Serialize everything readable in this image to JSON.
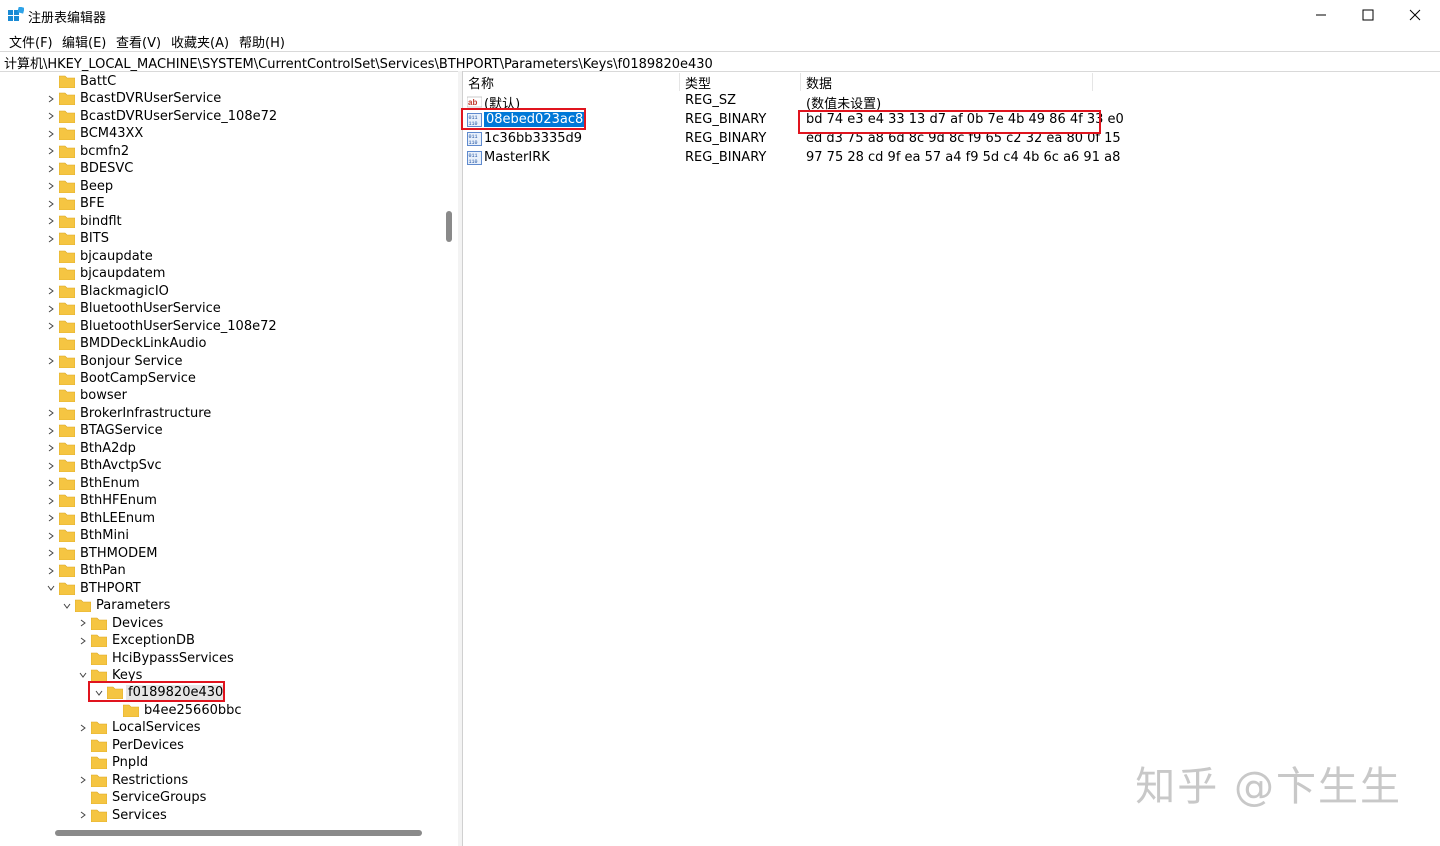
{
  "window": {
    "title": "注册表编辑器"
  },
  "menu": [
    "文件(F)",
    "编辑(E)",
    "查看(V)",
    "收藏夹(A)",
    "帮助(H)"
  ],
  "address": "计算机\\HKEY_LOCAL_MACHINE\\SYSTEM\\CurrentControlSet\\Services\\BTHPORT\\Parameters\\Keys\\f0189820e430",
  "tree": {
    "items": [
      {
        "label": "BattC",
        "level": 0,
        "expander": "none"
      },
      {
        "label": "BcastDVRUserService",
        "level": 0,
        "expander": "collapsed"
      },
      {
        "label": "BcastDVRUserService_108e72",
        "level": 0,
        "expander": "collapsed"
      },
      {
        "label": "BCM43XX",
        "level": 0,
        "expander": "collapsed"
      },
      {
        "label": "bcmfn2",
        "level": 0,
        "expander": "collapsed"
      },
      {
        "label": "BDESVC",
        "level": 0,
        "expander": "collapsed"
      },
      {
        "label": "Beep",
        "level": 0,
        "expander": "collapsed"
      },
      {
        "label": "BFE",
        "level": 0,
        "expander": "collapsed"
      },
      {
        "label": "bindflt",
        "level": 0,
        "expander": "collapsed"
      },
      {
        "label": "BITS",
        "level": 0,
        "expander": "collapsed"
      },
      {
        "label": "bjcaupdate",
        "level": 0,
        "expander": "none"
      },
      {
        "label": "bjcaupdatem",
        "level": 0,
        "expander": "none"
      },
      {
        "label": "BlackmagicIO",
        "level": 0,
        "expander": "collapsed"
      },
      {
        "label": "BluetoothUserService",
        "level": 0,
        "expander": "collapsed"
      },
      {
        "label": "BluetoothUserService_108e72",
        "level": 0,
        "expander": "collapsed"
      },
      {
        "label": "BMDDeckLinkAudio",
        "level": 0,
        "expander": "none"
      },
      {
        "label": "Bonjour Service",
        "level": 0,
        "expander": "collapsed"
      },
      {
        "label": "BootCampService",
        "level": 0,
        "expander": "none"
      },
      {
        "label": "bowser",
        "level": 0,
        "expander": "none"
      },
      {
        "label": "BrokerInfrastructure",
        "level": 0,
        "expander": "collapsed"
      },
      {
        "label": "BTAGService",
        "level": 0,
        "expander": "collapsed"
      },
      {
        "label": "BthA2dp",
        "level": 0,
        "expander": "collapsed"
      },
      {
        "label": "BthAvctpSvc",
        "level": 0,
        "expander": "collapsed"
      },
      {
        "label": "BthEnum",
        "level": 0,
        "expander": "collapsed"
      },
      {
        "label": "BthHFEnum",
        "level": 0,
        "expander": "collapsed"
      },
      {
        "label": "BthLEEnum",
        "level": 0,
        "expander": "collapsed"
      },
      {
        "label": "BthMini",
        "level": 0,
        "expander": "collapsed"
      },
      {
        "label": "BTHMODEM",
        "level": 0,
        "expander": "collapsed"
      },
      {
        "label": "BthPan",
        "level": 0,
        "expander": "collapsed"
      },
      {
        "label": "BTHPORT",
        "level": 0,
        "expander": "expanded"
      },
      {
        "label": "Parameters",
        "level": 1,
        "expander": "expanded"
      },
      {
        "label": "Devices",
        "level": 2,
        "expander": "collapsed"
      },
      {
        "label": "ExceptionDB",
        "level": 2,
        "expander": "collapsed"
      },
      {
        "label": "HciBypassServices",
        "level": 2,
        "expander": "none"
      },
      {
        "label": "Keys",
        "level": 2,
        "expander": "expanded"
      },
      {
        "label": "f0189820e430",
        "level": 3,
        "expander": "expanded",
        "selected": true
      },
      {
        "label": "b4ee25660bbc",
        "level": 4,
        "expander": "none"
      },
      {
        "label": "LocalServices",
        "level": 2,
        "expander": "collapsed"
      },
      {
        "label": "PerDevices",
        "level": 2,
        "expander": "none"
      },
      {
        "label": "PnpId",
        "level": 2,
        "expander": "none"
      },
      {
        "label": "Restrictions",
        "level": 2,
        "expander": "collapsed"
      },
      {
        "label": "ServiceGroups",
        "level": 2,
        "expander": "none"
      },
      {
        "label": "Services",
        "level": 2,
        "expander": "collapsed"
      }
    ]
  },
  "list": {
    "headers": [
      "名称",
      "类型",
      "数据"
    ],
    "rows": [
      {
        "name": "(默认)",
        "type": "REG_SZ",
        "data": "(数值未设置)",
        "icon": "string-value-icon"
      },
      {
        "name": "08ebed023ac8",
        "type": "REG_BINARY",
        "data": "bd 74 e3 e4 33 13 d7 af 0b 7e 4b 49 86 4f 33 e0",
        "icon": "binary-value-icon",
        "selected": true
      },
      {
        "name": "1c36bb3335d9",
        "type": "REG_BINARY",
        "data": "ed d3 75 a8 6d 8c 9d 8c f9 65 c2 32 ea 80 0f 15",
        "icon": "binary-value-icon"
      },
      {
        "name": "MasterIRK",
        "type": "REG_BINARY",
        "data": "97 75 28 cd 9f ea 57 a4 f9 5d c4 4b 6c a6 91 a8",
        "icon": "binary-value-icon"
      }
    ]
  },
  "watermark": "知乎 @卞生生",
  "colors": {
    "selection": "#0078d7",
    "highlight_box": "#e0141e",
    "folder": "#f5c542"
  }
}
